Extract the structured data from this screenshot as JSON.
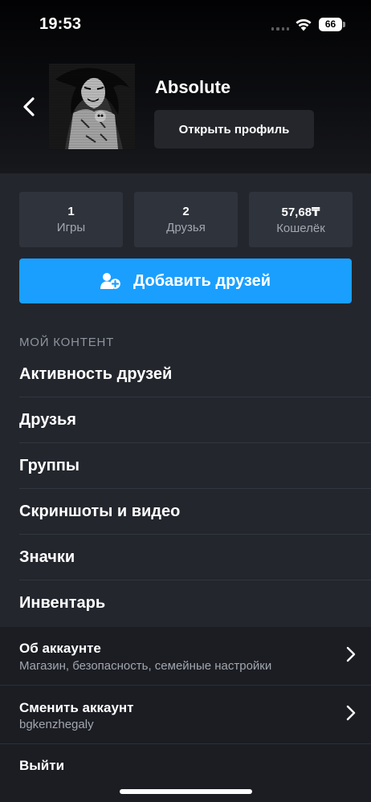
{
  "status_bar": {
    "time": "19:53",
    "battery": "66"
  },
  "profile": {
    "username": "Absolute",
    "open_profile_label": "Открыть профиль"
  },
  "stats": [
    {
      "value": "1",
      "label": "Игры"
    },
    {
      "value": "2",
      "label": "Друзья"
    },
    {
      "value": "57,68₸",
      "label": "Кошелёк"
    }
  ],
  "add_friends_label": "Добавить друзей",
  "my_content": {
    "header": "МОЙ КОНТЕНТ",
    "items": [
      "Активность друзей",
      "Друзья",
      "Группы",
      "Скриншоты и видео",
      "Значки",
      "Инвентарь"
    ]
  },
  "account": {
    "about_title": "Об аккаунте",
    "about_subtitle": "Магазин, безопасность, семейные настройки",
    "switch_title": "Сменить аккаунт",
    "switch_subtitle": "bgkenzhegaly",
    "logout_label": "Выйти"
  },
  "icons": {
    "back": "chevron-left-icon",
    "add_friend": "add-user-icon",
    "chevron": "chevron-right-icon",
    "wifi": "wifi-icon",
    "battery": "battery-icon"
  },
  "colors": {
    "accent": "#1a9fff",
    "header_bg": "#0c0d10",
    "panel_bg": "#23262d",
    "card_bg": "#2f333c",
    "settings_bg": "#1b1d23",
    "muted_text": "#a2a6ae"
  }
}
